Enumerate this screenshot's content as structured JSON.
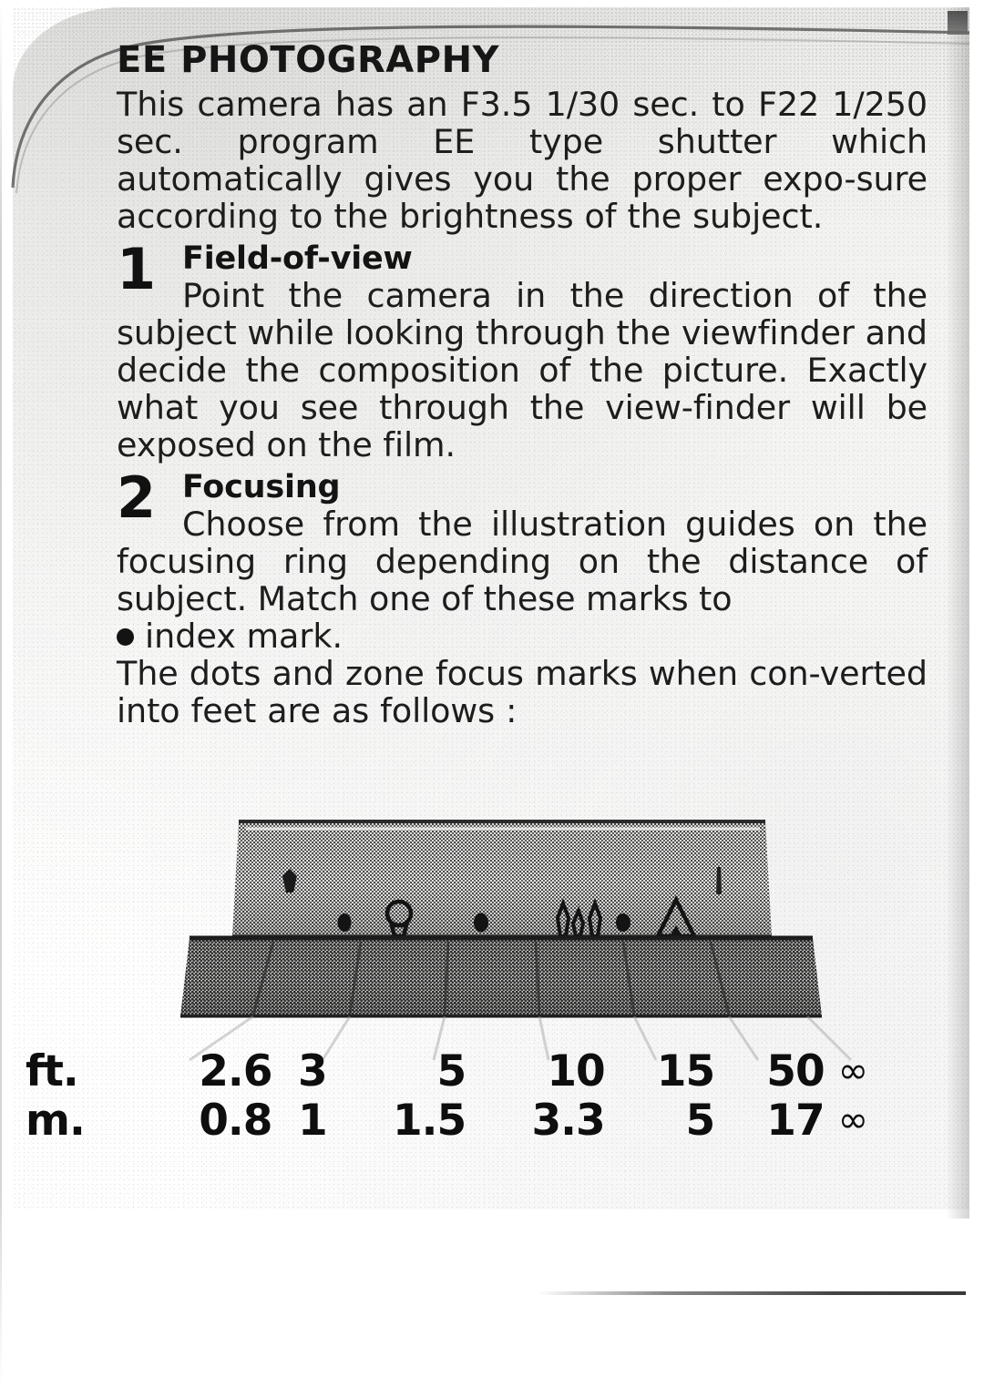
{
  "document": {
    "title": "EE PHOTOGRAPHY",
    "intro": "This camera has an F3.5 1/30 sec. to F22 1/250 sec. program EE type shutter which automatically gives you the proper expo-sure according to the brightness of the subject.",
    "sections": [
      {
        "number": "1",
        "heading": "Field-of-view",
        "body": "Point the camera in the direction of the subject while looking through the viewfinder and decide the composition of the picture. Exactly what you see through the view-finder will be exposed on the film."
      },
      {
        "number": "2",
        "heading": "Focusing",
        "body": "Choose from the illustration guides on the focusing ring depending on the distance of subject.  Match one of these marks to",
        "bullet_line": "index mark.",
        "bullet_icon": "filled-dot-icon"
      }
    ],
    "closing": "The dots and zone focus marks when con-verted into feet are as follows :"
  },
  "illustration": {
    "caption_name": "lens-focusing-ring-illustration",
    "index_mark_icon": "index-arrow-icon",
    "right_tick_icon": "tick-mark-icon",
    "zone_marks": [
      {
        "icon": "filled-dot-icon",
        "label": "dot"
      },
      {
        "icon": "portrait-person-icon",
        "label": "single person"
      },
      {
        "icon": "filled-dot-icon",
        "label": "dot"
      },
      {
        "icon": "group-people-icon",
        "label": "group of people"
      },
      {
        "icon": "filled-dot-icon",
        "label": "dot"
      },
      {
        "icon": "mountain-icon",
        "label": "mountain / landscape"
      }
    ]
  },
  "scale_table": {
    "rows": [
      {
        "unit": "ft.",
        "values": [
          "2.6",
          "3",
          "5",
          "10",
          "15",
          "50"
        ],
        "infinity": "∞"
      },
      {
        "unit": "m.",
        "values": [
          "0.8",
          "1",
          "1.5",
          "3.3",
          "5",
          "17"
        ],
        "infinity": "∞"
      }
    ]
  },
  "colors": {
    "ink": "#1d1d1d",
    "paper": "#fbfbfa",
    "paper_shadow": "#e6e6e4"
  }
}
